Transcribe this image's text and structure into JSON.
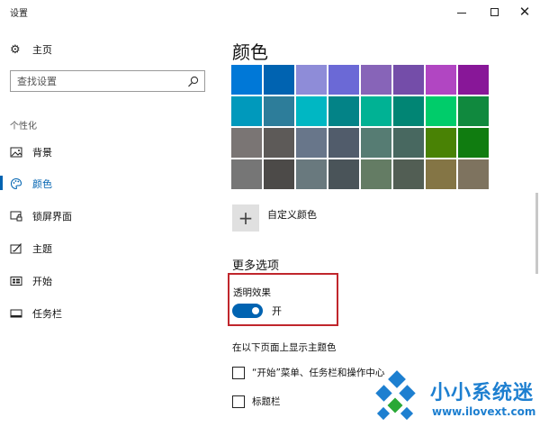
{
  "window": {
    "title": "设置",
    "minimize_icon": "minimize-icon",
    "maximize_icon": "maximize-icon",
    "close_icon": "close-icon",
    "close_glyph": "✕"
  },
  "sidebar": {
    "home": {
      "label": "主页",
      "icon": "gear-icon",
      "glyph": "⚙"
    },
    "search": {
      "placeholder": "查找设置",
      "value": "",
      "icon": "search-icon"
    },
    "section_label": "个性化",
    "items": [
      {
        "label": "背景",
        "icon": "picture-icon",
        "active": false
      },
      {
        "label": "颜色",
        "icon": "palette-icon",
        "active": true
      },
      {
        "label": "锁屏界面",
        "icon": "lock-screen-icon",
        "active": false
      },
      {
        "label": "主题",
        "icon": "theme-icon",
        "active": false
      },
      {
        "label": "开始",
        "icon": "start-icon",
        "active": false
      },
      {
        "label": "任务栏",
        "icon": "taskbar-icon",
        "active": false
      }
    ]
  },
  "main": {
    "heading": "颜色",
    "swatches": [
      "#0078d7",
      "#0063b1",
      "#8e8cd8",
      "#6b69d6",
      "#8764b8",
      "#744da9",
      "#b146c2",
      "#881798",
      "#0099bc",
      "#2d7d9a",
      "#00b7c3",
      "#038387",
      "#00b294",
      "#018574",
      "#00cc6a",
      "#10893e",
      "#7a7574",
      "#5d5a58",
      "#68768a",
      "#515c6b",
      "#567c73",
      "#486860",
      "#498205",
      "#107c10",
      "#767676",
      "#4c4a48",
      "#69797e",
      "#4a5459",
      "#647c64",
      "#525e54",
      "#847545",
      "#7e735f"
    ],
    "custom_color": {
      "label": "自定义颜色",
      "icon": "plus-icon",
      "glyph": "+"
    },
    "more_options": "更多选项",
    "transparency": {
      "label": "透明效果",
      "state": "开",
      "on": true
    },
    "show_accent_label": "在以下页面上显示主题色",
    "checkboxes": [
      {
        "label": "“开始”菜单、任务栏和操作中心",
        "checked": false
      },
      {
        "label": "标题栏",
        "checked": false
      }
    ]
  },
  "watermark": {
    "title": "小小系统迷",
    "url": "www.ilovext.com"
  },
  "colors": {
    "accent": "#0063b1",
    "highlight_box": "#c0262c",
    "watermark": "#1d7fd0"
  }
}
